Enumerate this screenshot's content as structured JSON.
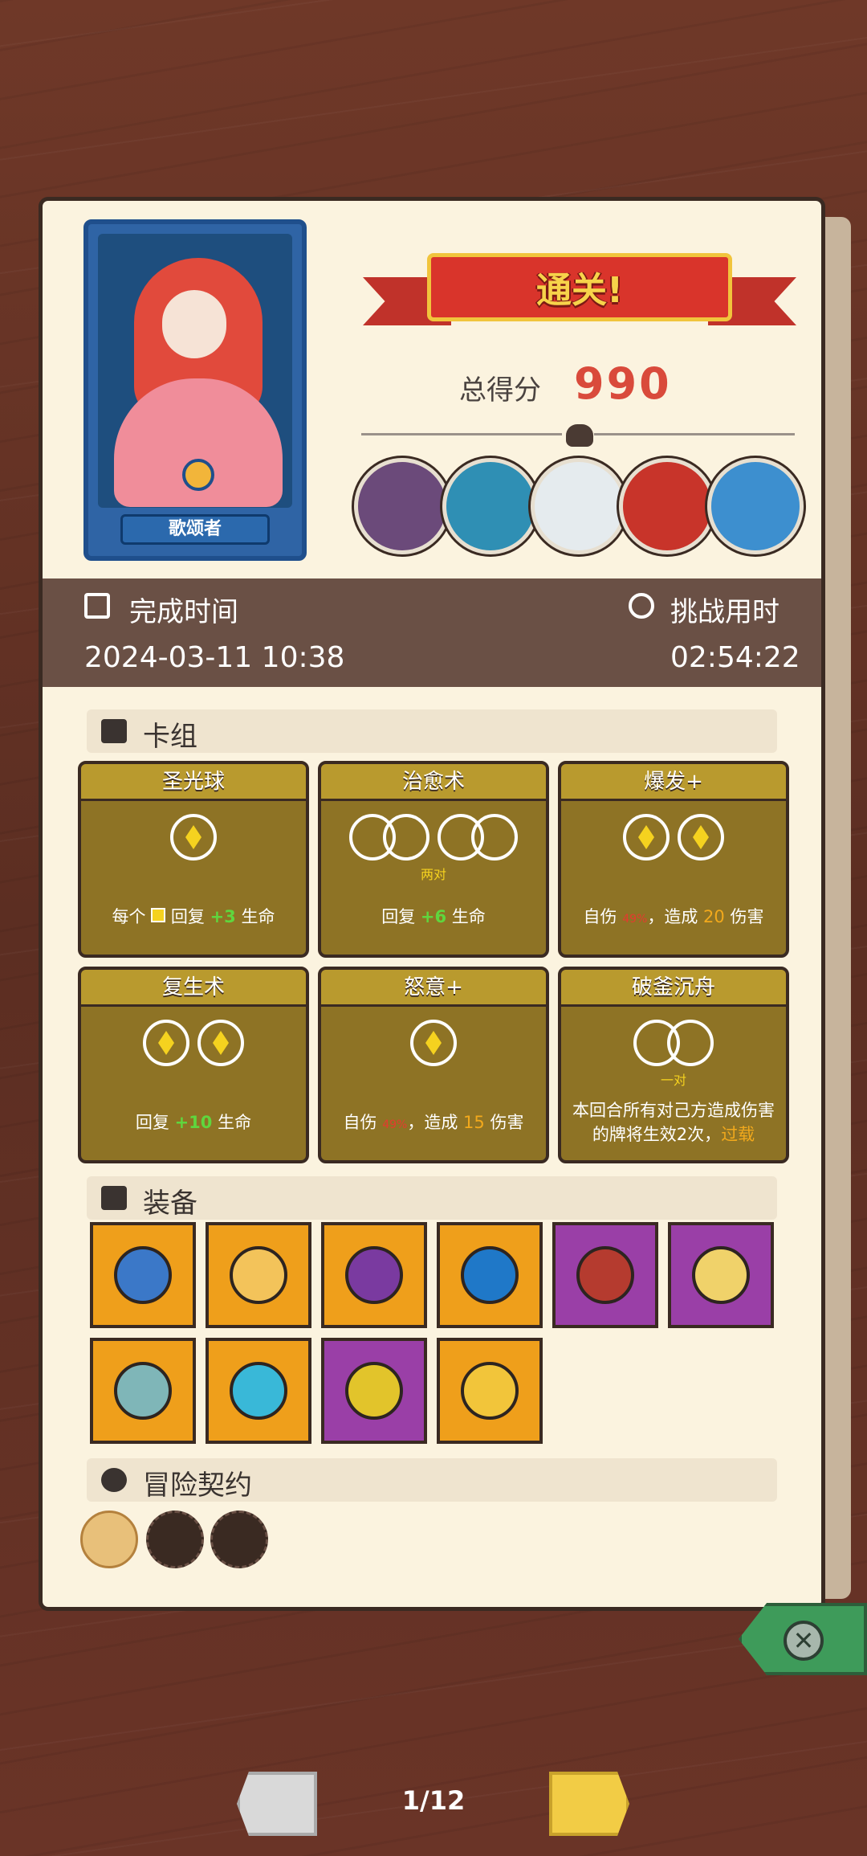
{
  "result": {
    "title": "通关!",
    "score_label": "总得分",
    "score_value": "990"
  },
  "hero": {
    "name": "歌颂者"
  },
  "bosses": [
    "boss-1",
    "boss-2",
    "boss-3",
    "boss-4",
    "boss-5"
  ],
  "times": {
    "finish_label": "完成时间",
    "finish_value": "2024-03-11 10:38",
    "challenge_label": "挑战用时",
    "challenge_value": "02:54:22"
  },
  "sections": {
    "deck": "卡组",
    "equipment": "装备",
    "contracts": "冒险契约"
  },
  "cards": [
    {
      "name": "圣光球",
      "desc_a": "每个 ",
      "desc_b": " 回复 ",
      "desc_val": "+3",
      "desc_c": " 生命"
    },
    {
      "name": "治愈术",
      "note": "两对",
      "desc_a": "回复 ",
      "desc_val": "+6",
      "desc_c": " 生命"
    },
    {
      "name": "爆发+",
      "desc_a": "自伤 ",
      "desc_pct": "49%",
      "desc_b": "，造成 ",
      "desc_val": "20",
      "desc_c": " 伤害"
    },
    {
      "name": "复生术",
      "desc_a": "回复 ",
      "desc_val": "+10",
      "desc_c": " 生命"
    },
    {
      "name": "怒意+",
      "desc_a": "自伤 ",
      "desc_pct": "49%",
      "desc_b": "，造成 ",
      "desc_val": "15",
      "desc_c": " 伤害"
    },
    {
      "name": "破釜沉舟",
      "note": "一对",
      "desc_a": "本回合所有对己方造成伤害的牌将生效2次，",
      "desc_link": "过载"
    }
  ],
  "equipment": [
    {
      "icon": "spiked-orb-icon",
      "rarity": "orange"
    },
    {
      "icon": "treasure-bag-icon",
      "rarity": "orange"
    },
    {
      "icon": "purple-hood-icon",
      "rarity": "orange"
    },
    {
      "icon": "swirl-orb-key-icon",
      "rarity": "orange"
    },
    {
      "icon": "red-bracelet-icon",
      "rarity": "purple"
    },
    {
      "icon": "golden-compass-icon",
      "rarity": "purple"
    },
    {
      "icon": "teal-vase-icon",
      "rarity": "orange"
    },
    {
      "icon": "crystal-crown-icon",
      "rarity": "orange"
    },
    {
      "icon": "golden-eye-box-icon",
      "rarity": "purple"
    },
    {
      "icon": "gold-crown-icon",
      "rarity": "orange"
    }
  ],
  "contracts": [
    "scroll-icon",
    "green-lizard-icon",
    "green-potion-icon"
  ],
  "pager": {
    "label": "1/12"
  },
  "colors": {
    "orange": "#ef9f1b",
    "purple": "#9a3fa7",
    "card": "#8e7325",
    "accent_red": "#d94a3b"
  }
}
